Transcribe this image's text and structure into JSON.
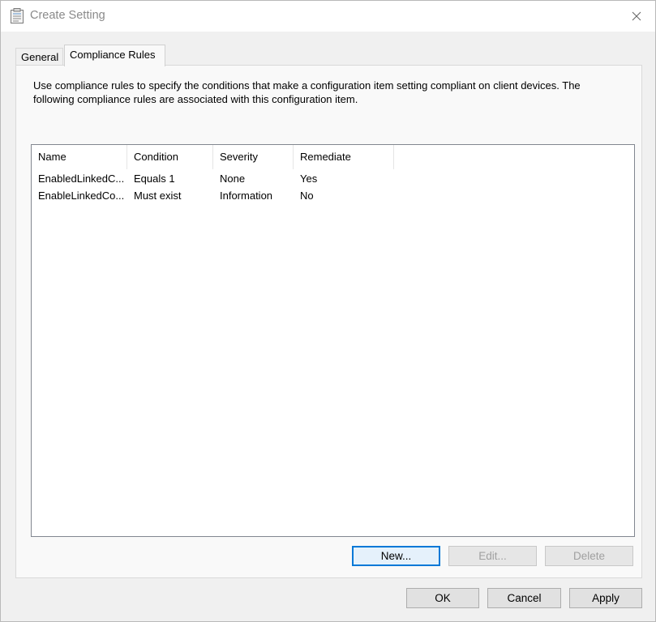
{
  "window": {
    "title": "Create Setting",
    "icon": "properties-icon"
  },
  "tabs": [
    {
      "label": "General",
      "selected": false
    },
    {
      "label": "Compliance Rules",
      "selected": true
    }
  ],
  "compliance": {
    "description": "Use compliance rules to specify the conditions that make a configuration item setting compliant on client devices. The following compliance rules are associated with this configuration item.",
    "columns": [
      "Name",
      "Condition",
      "Severity",
      "Remediate"
    ],
    "rows": [
      {
        "name": "EnabledLinkedC...",
        "condition": "Equals 1",
        "severity": "None",
        "remediate": "Yes"
      },
      {
        "name": "EnableLinkedCo...",
        "condition": "Must exist",
        "severity": "Information",
        "remediate": "No"
      }
    ],
    "buttons": {
      "new": "New...",
      "edit": "Edit...",
      "delete": "Delete"
    }
  },
  "footer": {
    "ok": "OK",
    "cancel": "Cancel",
    "apply": "Apply"
  },
  "colors": {
    "accent": "#0078d7",
    "panel": "#f9f9f9",
    "window": "#f0f0f0"
  }
}
